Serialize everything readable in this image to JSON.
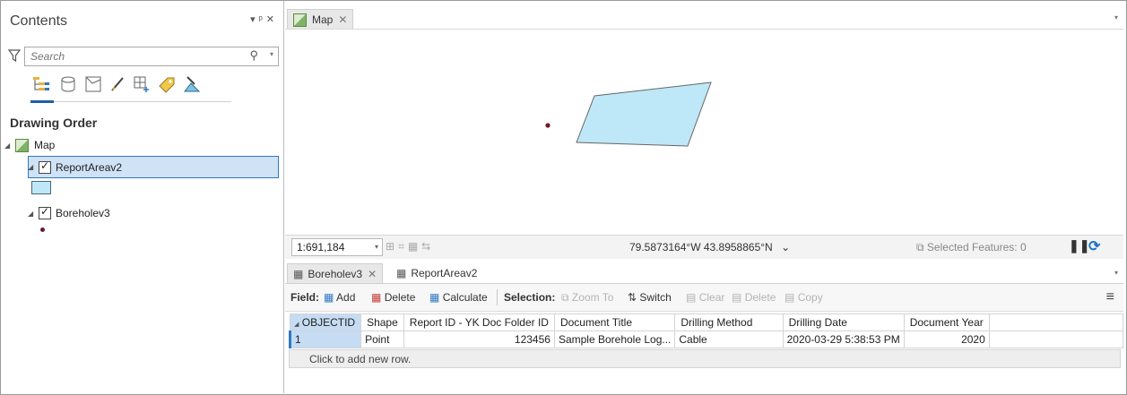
{
  "contents": {
    "title": "Contents",
    "controls": "▾ ᵖ ✕",
    "search_placeholder": "Search",
    "section_title": "Drawing Order",
    "tree": {
      "map": "Map",
      "layer1": "ReportAreav2",
      "layer2": "Boreholev3"
    }
  },
  "map": {
    "tab_label": "Map",
    "scale": "1:691,184",
    "coordinates": "79.5873164°W 43.8958865°N",
    "selected_features": "Selected Features: 0"
  },
  "table": {
    "tabs": [
      "Boreholev3",
      "ReportAreav2"
    ],
    "toolbar": {
      "field_label": "Field:",
      "add": "Add",
      "delete": "Delete",
      "calculate": "Calculate",
      "selection_label": "Selection:",
      "zoom_to": "Zoom To",
      "switch": "Switch",
      "clear": "Clear",
      "delete2": "Delete",
      "copy": "Copy"
    },
    "columns": [
      "OBJECTID",
      "Shape",
      "Report ID - YK Doc Folder ID",
      "Document Title",
      "Drilling Method",
      "Drilling Date",
      "Document Year"
    ],
    "rows": [
      [
        "1",
        "Point",
        "123456",
        "Sample Borehole Log...",
        "Cable",
        "2020-03-29 5:38:53 PM",
        "2020"
      ]
    ],
    "add_row": "Click to add new row."
  },
  "colors": {
    "polygon_fill": "#bee8f7",
    "selection_blue": "#2f78c4",
    "point": "#6b1a2a"
  }
}
